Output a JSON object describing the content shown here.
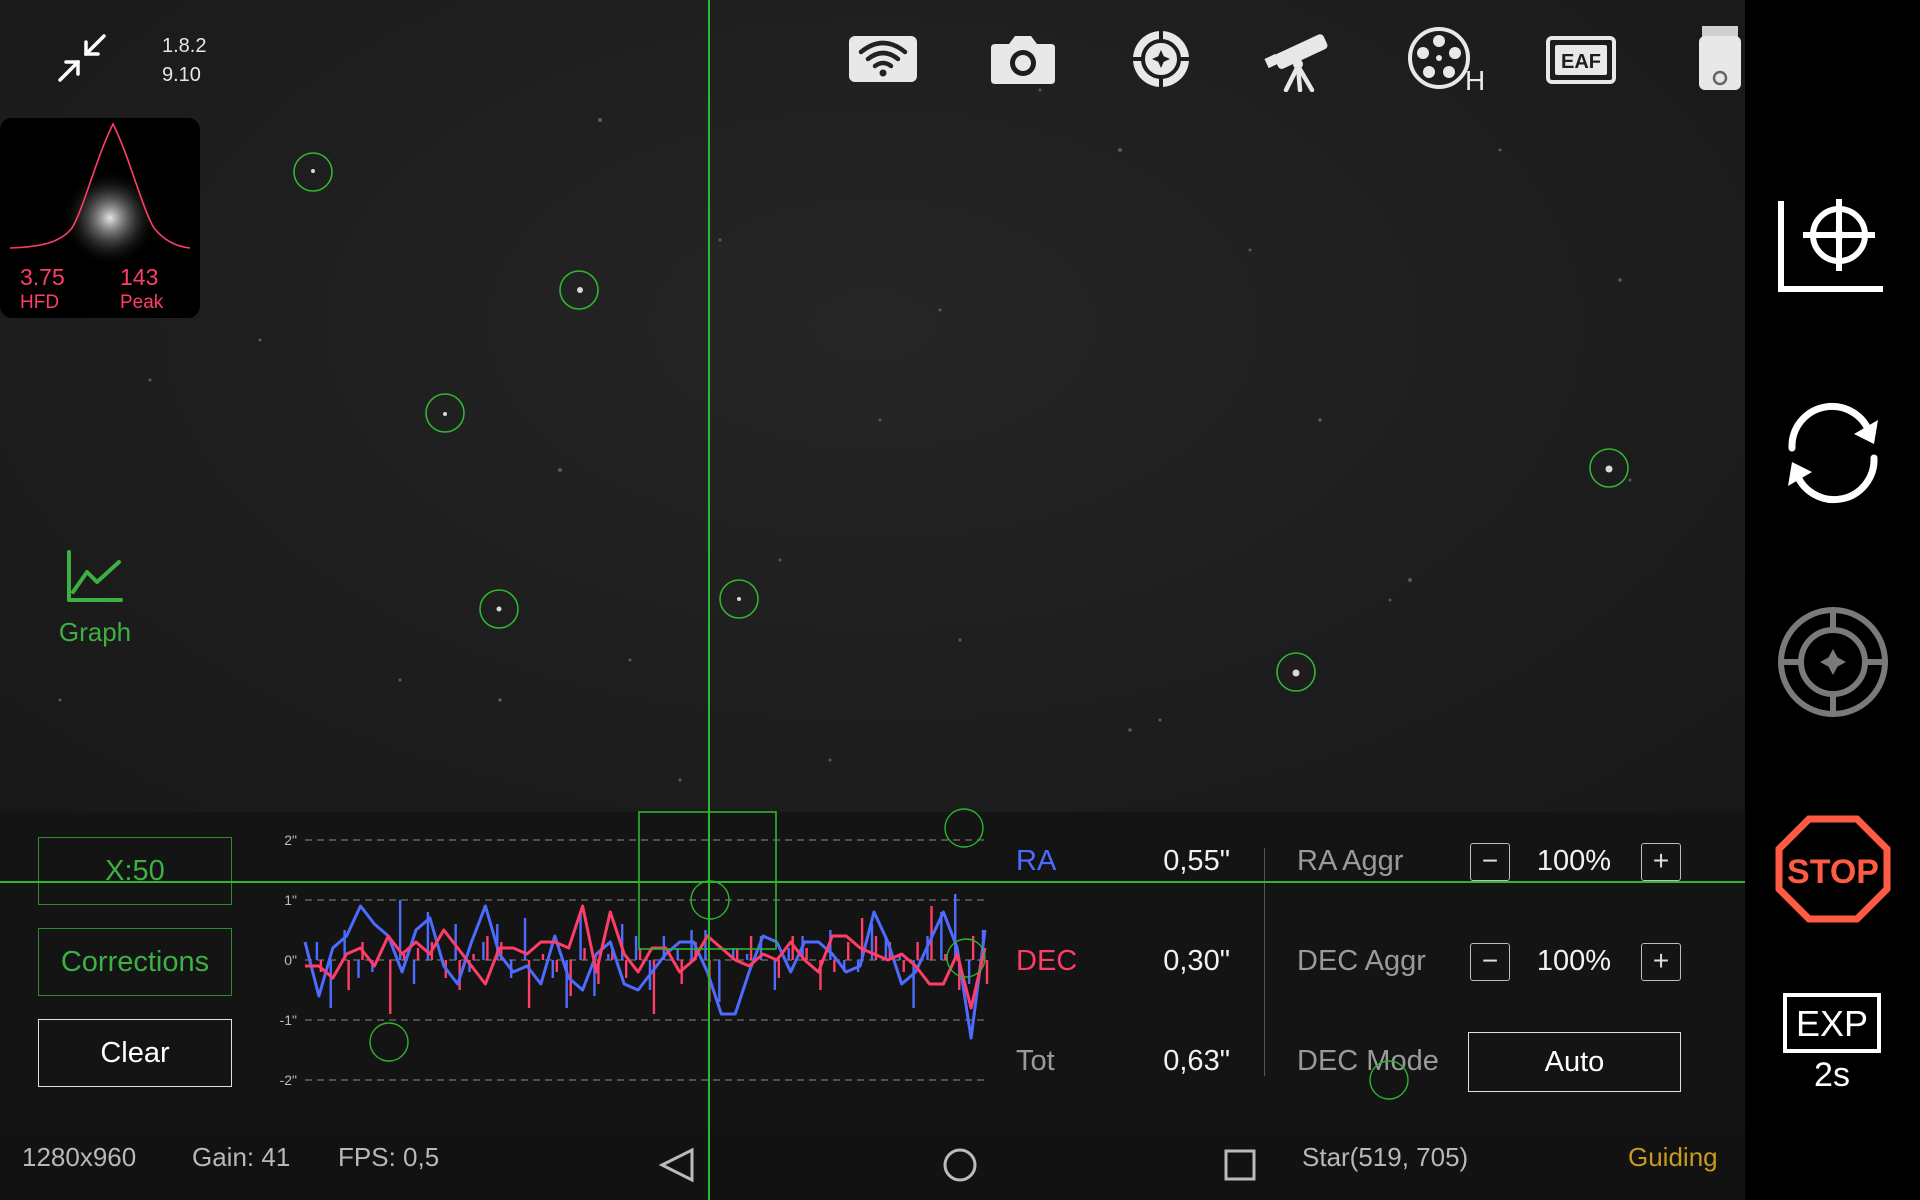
{
  "version": {
    "line1": "1.8.2",
    "line2": "9.10"
  },
  "hfd": {
    "hfd_value": "3.75",
    "hfd_label": "HFD",
    "peak_value": "143",
    "peak_label": "Peak"
  },
  "graph_toggle": {
    "label": "Graph"
  },
  "top_toolbar": {
    "icons": [
      "wifi-icon",
      "camera-icon",
      "guide-target-icon",
      "telescope-icon",
      "filter-wheel-icon",
      "eaf-icon",
      "usb-drive-icon",
      "info-icon"
    ],
    "filter_wheel_badge": "H",
    "eaf_label": "EAF"
  },
  "right_sidebar": {
    "icons": [
      "calibrate-icon",
      "loop-icon",
      "guide-icon",
      "stop-icon",
      "exposure-icon"
    ],
    "stop_label": "STOP",
    "exp_label": "EXP",
    "exposure_value": "2s"
  },
  "panel": {
    "x_scale_button": "X:50",
    "corrections_button": "Corrections",
    "clear_button": "Clear"
  },
  "stats": {
    "ra_label": "RA",
    "ra_value": "0,55\"",
    "dec_label": "DEC",
    "dec_value": "0,30\"",
    "tot_label": "Tot",
    "tot_value": "0,63\""
  },
  "aggressiveness": {
    "ra_label": "RA Aggr",
    "ra_value": "100%",
    "dec_label": "DEC Aggr",
    "dec_value": "100%",
    "minus": "−",
    "plus": "+",
    "dec_mode_label": "DEC Mode",
    "dec_mode_value": "Auto"
  },
  "status_bar": {
    "resolution": "1280x960",
    "gain": "Gain: 41",
    "fps": "FPS: 0,5",
    "star": "Star(519, 705)",
    "state": "Guiding"
  },
  "colors": {
    "ra": "#4d6cff",
    "dec": "#ff3d66",
    "accent": "#3cb043",
    "guiding": "#c69a1c"
  },
  "chart_data": {
    "type": "line",
    "y_tick_labels": [
      "2\"",
      "1\"",
      "0\"",
      "-1\"",
      "-2\""
    ],
    "ylim": [
      -2,
      2
    ],
    "grid": true,
    "series": [
      {
        "name": "RA",
        "values": [
          0.3,
          -0.6,
          0.2,
          0.4,
          0.9,
          0.6,
          0.4,
          -0.2,
          0.5,
          0.7,
          -0.1,
          -0.4,
          0.3,
          0.9,
          0.1,
          -0.2,
          -0.1,
          -0.4,
          0.4,
          -0.3,
          -0.5,
          0.1,
          0.3,
          -0.4,
          -0.5,
          -0.2,
          0.1,
          0.3,
          0.3,
          -0.2,
          -0.9,
          -0.9,
          -0.2,
          0.4,
          0.3,
          -0.2,
          0.3,
          0.3,
          0.1,
          -0.2,
          -0.1,
          0.8,
          0.3,
          -0.4,
          -0.2,
          0.3,
          0.8,
          0.2,
          -1.3,
          0.5
        ]
      },
      {
        "name": "DEC",
        "values": [
          -0.1,
          -0.1,
          -0.3,
          0.1,
          0.2,
          -0.1,
          0.4,
          0.1,
          0.3,
          0.1,
          0.5,
          0.2,
          -0.1,
          -0.4,
          0.2,
          0.2,
          0.1,
          0.3,
          0.3,
          0.2,
          0.9,
          -0.2,
          0.8,
          0.1,
          -0.2,
          0.2,
          0.2,
          -0.2,
          0.0,
          0.4,
          0.2,
          0.0,
          -0.1,
          0.1,
          0.0,
          0.3,
          0.0,
          -0.2,
          0.4,
          0.4,
          0.2,
          0.1,
          0.0,
          0.1,
          -0.1,
          -0.4,
          -0.4,
          0.1,
          -0.8,
          0.2
        ]
      }
    ],
    "ra_corrections": [
      0,
      0.3,
      -0.8,
      0.5,
      -0.3,
      -0.2,
      0,
      1,
      -0.4,
      0.8,
      0,
      0.6,
      -0.2,
      0.3,
      0.6,
      -0.3,
      0.7,
      0,
      -0.3,
      -0.8,
      0.8,
      -0.6,
      0.1,
      0.6,
      0.4,
      -0.5,
      0.4,
      0.2,
      0.5,
      0.5,
      -0.7,
      0.2,
      0.1,
      0.4,
      -0.5,
      0.2,
      0.4,
      0,
      0.5,
      -0.2,
      -0.2,
      0.6,
      0.4,
      0.1,
      -0.8,
      0.4,
      0.8,
      1.1,
      -0.4,
      0.5
    ],
    "dec_corrections": [
      0,
      -0.2,
      0,
      -0.5,
      0.3,
      0,
      -0.9,
      0.1,
      0.2,
      0.3,
      -0.3,
      -0.5,
      0.1,
      0.4,
      0.3,
      0,
      -0.8,
      0.1,
      -0.2,
      -0.6,
      0.2,
      -0.4,
      0.2,
      -0.3,
      0.2,
      -0.9,
      0,
      -0.4,
      0.3,
      -0.7,
      0,
      0.2,
      0.4,
      0,
      -0.3,
      0.4,
      0.2,
      -0.5,
      -0.2,
      0.3,
      0.7,
      0.4,
      0.3,
      -0.2,
      0.3,
      0.9,
      0.1,
      -0.5,
      0.4,
      -0.4
    ]
  }
}
